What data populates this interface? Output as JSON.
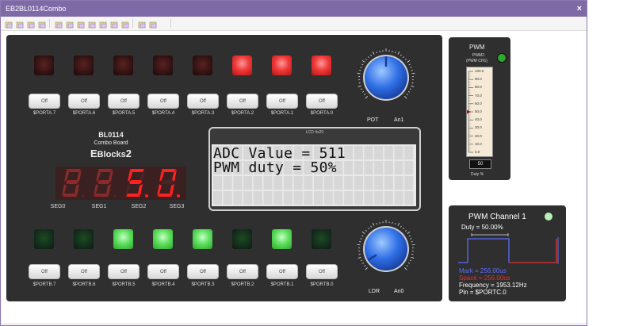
{
  "window": {
    "title": "EB2BL0114Combo",
    "close": "×"
  },
  "toolbar": {
    "icons": [
      "new-icon",
      "open-icon",
      "save-icon",
      "copy-icon",
      "paste-icon",
      "print-icon",
      "component-icon",
      "probe-icon",
      "chart-icon",
      "step-icon",
      "run-icon",
      "pause-icon",
      "settings-icon"
    ]
  },
  "porta": {
    "leds": [
      "off",
      "off",
      "off",
      "off",
      "off",
      "on",
      "on",
      "on"
    ],
    "switch_label": "Off",
    "labels": [
      "$PORTA.7",
      "$PORTA.6",
      "$PORTA.5",
      "$PORTA.4",
      "$PORTA.3",
      "$PORTA.2",
      "$PORTA.1",
      "$PORTA.0"
    ]
  },
  "portb": {
    "leds": [
      "off",
      "off",
      "on",
      "on",
      "on",
      "off",
      "on",
      "off"
    ],
    "switch_label": "Off",
    "labels": [
      "$PORTB.7",
      "$PORTB.6",
      "$PORTB.5",
      "$PORTB.4",
      "$PORTB.3",
      "$PORTB.2",
      "$PORTB.1",
      "$PORTB.0"
    ]
  },
  "board": {
    "name": "BL0114",
    "subtitle": "Combo Board",
    "brand_e": "E",
    "brand_blocks": "Blocks",
    "brand_num": "2"
  },
  "segments": {
    "labels": [
      "SEG0",
      "SEG1",
      "SEG2",
      "SEG3"
    ],
    "digits": [
      "8",
      "8",
      "5",
      "0"
    ],
    "lit": [
      false,
      false,
      true,
      true
    ]
  },
  "lcd": {
    "title": "LCD 4x20",
    "line1": "ADC Value = 511",
    "line2": "PWM duty = 50%"
  },
  "pot": {
    "name": "POT",
    "channel": "An1",
    "value_fraction": 0.5
  },
  "ldr": {
    "name": "LDR",
    "channel": "An0",
    "value_fraction": 0.05
  },
  "knob_ticks": [
    "0",
    "10",
    "20",
    "30",
    "40",
    "50",
    "60",
    "70",
    "80",
    "90",
    "100"
  ],
  "pwm": {
    "title": "PWM",
    "sub1": "PWM2",
    "sub2": "(PWM CH1)",
    "scale": [
      "100.0",
      "90.0",
      "80.0",
      "70.0",
      "60.0",
      "50.0",
      "40.0",
      "30.0",
      "20.0",
      "10.0",
      "0.0"
    ],
    "value": "50",
    "unit": "Duty %",
    "fraction": 0.5,
    "led_color": "#2fa82f"
  },
  "channel1": {
    "title": "PWM Channel 1",
    "duty": "Duty = 50.00%",
    "mark": "Mark = 256.00us",
    "space": "Space = 256.00us",
    "frequency": "Frequency = 1953.12Hz",
    "pin": "Pin = $PORTC.0",
    "mark_color": "#5c6cff",
    "space_color": "#e23030",
    "led_color": "#b8f0b8"
  }
}
